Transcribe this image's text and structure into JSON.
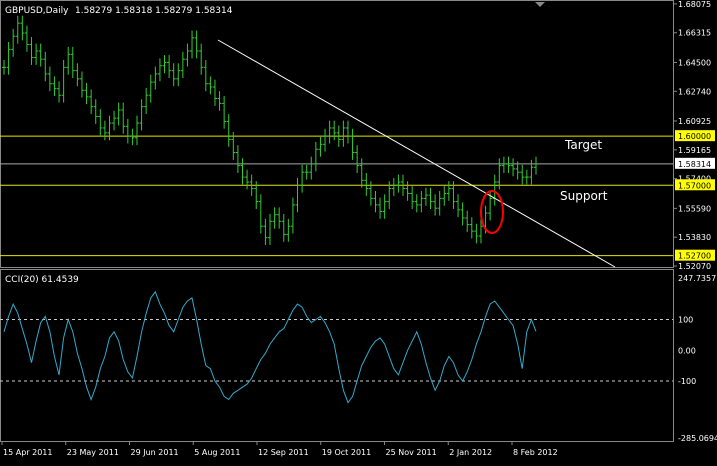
{
  "header": {
    "symbol_label": "GBPUSD,Daily",
    "ohlc": "1.58279 1.58318 1.58279 1.58314"
  },
  "indicator": {
    "label": "CCI(20) 61.4539"
  },
  "annotations": {
    "target_label": "Target",
    "support_label": "Support"
  },
  "colors": {
    "background": "#000000",
    "bars": "#33cc33",
    "cci_line": "#33aacc",
    "level_line": "#e6e600",
    "trendline": "#ffffff",
    "price_marker": "#ffff00",
    "circle": "#ff0000",
    "axis_text": "#ffffff"
  },
  "chart_data": [
    {
      "type": "bar",
      "title": "GBPUSD,Daily",
      "series": [
        {
          "name": "GBPUSD",
          "values": [
            1.642,
            1.653,
            1.661,
            1.669,
            1.663,
            1.656,
            1.648,
            1.652,
            1.647,
            1.638,
            1.632,
            1.629,
            1.625,
            1.642,
            1.65,
            1.64,
            1.635,
            1.628,
            1.624,
            1.618,
            1.612,
            1.605,
            1.602,
            1.608,
            1.611,
            1.616,
            1.606,
            1.6,
            1.599,
            1.608,
            1.618,
            1.625,
            1.633,
            1.638,
            1.643,
            1.645,
            1.64,
            1.635,
            1.64,
            1.647,
            1.652,
            1.66,
            1.652,
            1.642,
            1.632,
            1.63,
            1.623,
            1.62,
            1.609,
            1.598,
            1.59,
            1.582,
            1.575,
            1.572,
            1.568,
            1.56,
            1.545,
            1.538,
            1.548,
            1.552,
            1.548,
            1.54,
            1.545,
            1.558,
            1.57,
            1.578,
            1.578,
            1.583,
            1.592,
            1.595,
            1.6,
            1.605,
            1.602,
            1.598,
            1.605,
            1.6,
            1.59,
            1.582,
            1.573,
            1.568,
            1.562,
            1.558,
            1.554,
            1.56,
            1.568,
            1.57,
            1.572,
            1.568,
            1.565,
            1.56,
            1.558,
            1.562,
            1.564,
            1.56,
            1.556,
            1.562,
            1.565,
            1.568,
            1.56,
            1.555,
            1.55,
            1.546,
            1.542,
            1.539,
            1.545,
            1.553,
            1.562,
            1.572,
            1.582,
            1.583,
            1.582,
            1.58,
            1.578,
            1.575,
            1.575,
            1.581,
            1.583
          ]
        }
      ],
      "x_tick_labels": [
        "15 Apr 2011",
        "23 May 2011",
        "29 Jun 2011",
        "5 Aug 2011",
        "12 Sep 2011",
        "19 Oct 2011",
        "25 Nov 2011",
        "2 Jan 2012",
        "8 Feb 2012"
      ],
      "y_tick_labels": [
        "1.68075",
        "1.66315",
        "1.64500",
        "1.62740",
        "1.60925",
        "1.59165",
        "1.57400",
        "1.55590",
        "1.53830",
        "1.52070"
      ],
      "ylim": [
        1.5207,
        1.6807
      ],
      "horizontal_levels": [
        {
          "value": 1.6,
          "label": "1.60000"
        },
        {
          "value": 1.5831,
          "label": "1.58314"
        },
        {
          "value": 1.57,
          "label": "1.57000"
        },
        {
          "value": 1.527,
          "label": "1.52700"
        }
      ]
    },
    {
      "type": "line",
      "title": "CCI(20) 61.4539",
      "series": [
        {
          "name": "CCI(20)",
          "values": [
            60,
            110,
            150,
            120,
            70,
            20,
            -40,
            30,
            90,
            110,
            60,
            -20,
            -80,
            40,
            100,
            60,
            -10,
            -60,
            -120,
            -160,
            -120,
            -60,
            -20,
            40,
            60,
            30,
            -30,
            -70,
            -90,
            -20,
            60,
            120,
            170,
            190,
            150,
            120,
            80,
            60,
            100,
            140,
            160,
            170,
            100,
            20,
            -50,
            -60,
            -100,
            -120,
            -150,
            -160,
            -140,
            -130,
            -120,
            -110,
            -90,
            -60,
            -30,
            -10,
            20,
            40,
            60,
            70,
            100,
            130,
            150,
            140,
            110,
            90,
            100,
            110,
            90,
            60,
            20,
            -60,
            -130,
            -170,
            -150,
            -100,
            -50,
            -20,
            10,
            30,
            40,
            20,
            -20,
            -60,
            -80,
            -40,
            0,
            30,
            60,
            20,
            -40,
            -90,
            -130,
            -100,
            -50,
            -20,
            -40,
            -80,
            -100,
            -70,
            -30,
            20,
            60,
            110,
            150,
            160,
            140,
            120,
            100,
            80,
            20,
            -60,
            60,
            100,
            61.45
          ]
        }
      ],
      "y_tick_labels": [
        "247.7357",
        "100",
        "0.00",
        "-100",
        "-285.0694"
      ],
      "ylim": [
        -285.0694,
        247.7357
      ],
      "dashed_levels": [
        100,
        -100
      ]
    }
  ]
}
